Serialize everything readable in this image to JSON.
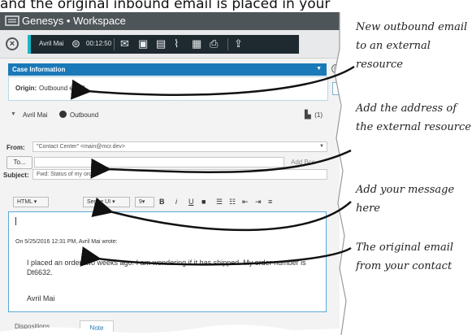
{
  "caption": "and the original inbound email is placed in your",
  "window": {
    "title": "Genesys • Workspace"
  },
  "toolbar": {
    "agent": "Avril Mai",
    "timer": "00:12:50"
  },
  "case": {
    "header": "Case Information",
    "origin_label": "Origin:",
    "origin_value": "Outbound email"
  },
  "party": {
    "name": "Avril Mai",
    "direction": "Outbound",
    "count": "(1)"
  },
  "email": {
    "from_label": "From:",
    "from_value": "\"Contact Center\" <main@mcr.dev>",
    "to_button": "To...",
    "to_value": "",
    "add_label": "Add Bcc",
    "subject_label": "Subject:",
    "subject_value": "Fwd: Status of my order"
  },
  "format": {
    "type": "HTML",
    "font": "Segoe UI",
    "size": "9"
  },
  "body": {
    "wrote": "On 5/25/2016 12:31 PM, Avril Mai wrote:",
    "quote": "I placed an order two weeks ago. I am wondering if it has shipped. My order number is Dt6632.",
    "signature": "Avril Mai"
  },
  "tabs": {
    "dispositions": "Dispositions",
    "note": "Note"
  },
  "callouts": {
    "c1": "New outbound email to an external resource",
    "c2": "Add the address of the external resource",
    "c3": "Add your message here",
    "c4": "The original email from your contact"
  }
}
